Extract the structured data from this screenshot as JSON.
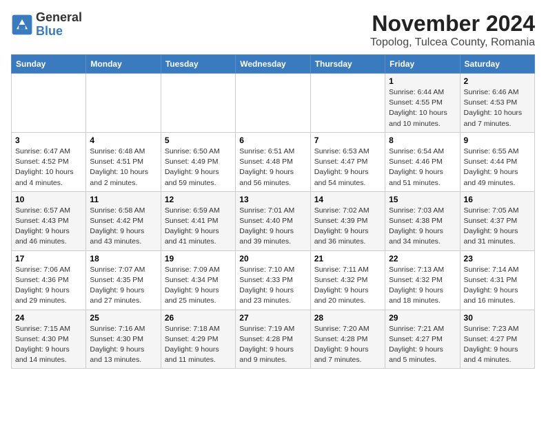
{
  "header": {
    "logo_general": "General",
    "logo_blue": "Blue",
    "title": "November 2024",
    "subtitle": "Topolog, Tulcea County, Romania"
  },
  "calendar": {
    "weekdays": [
      "Sunday",
      "Monday",
      "Tuesday",
      "Wednesday",
      "Thursday",
      "Friday",
      "Saturday"
    ],
    "weeks": [
      [
        {
          "day": "",
          "info": ""
        },
        {
          "day": "",
          "info": ""
        },
        {
          "day": "",
          "info": ""
        },
        {
          "day": "",
          "info": ""
        },
        {
          "day": "",
          "info": ""
        },
        {
          "day": "1",
          "info": "Sunrise: 6:44 AM\nSunset: 4:55 PM\nDaylight: 10 hours and 10 minutes."
        },
        {
          "day": "2",
          "info": "Sunrise: 6:46 AM\nSunset: 4:53 PM\nDaylight: 10 hours and 7 minutes."
        }
      ],
      [
        {
          "day": "3",
          "info": "Sunrise: 6:47 AM\nSunset: 4:52 PM\nDaylight: 10 hours and 4 minutes."
        },
        {
          "day": "4",
          "info": "Sunrise: 6:48 AM\nSunset: 4:51 PM\nDaylight: 10 hours and 2 minutes."
        },
        {
          "day": "5",
          "info": "Sunrise: 6:50 AM\nSunset: 4:49 PM\nDaylight: 9 hours and 59 minutes."
        },
        {
          "day": "6",
          "info": "Sunrise: 6:51 AM\nSunset: 4:48 PM\nDaylight: 9 hours and 56 minutes."
        },
        {
          "day": "7",
          "info": "Sunrise: 6:53 AM\nSunset: 4:47 PM\nDaylight: 9 hours and 54 minutes."
        },
        {
          "day": "8",
          "info": "Sunrise: 6:54 AM\nSunset: 4:46 PM\nDaylight: 9 hours and 51 minutes."
        },
        {
          "day": "9",
          "info": "Sunrise: 6:55 AM\nSunset: 4:44 PM\nDaylight: 9 hours and 49 minutes."
        }
      ],
      [
        {
          "day": "10",
          "info": "Sunrise: 6:57 AM\nSunset: 4:43 PM\nDaylight: 9 hours and 46 minutes."
        },
        {
          "day": "11",
          "info": "Sunrise: 6:58 AM\nSunset: 4:42 PM\nDaylight: 9 hours and 43 minutes."
        },
        {
          "day": "12",
          "info": "Sunrise: 6:59 AM\nSunset: 4:41 PM\nDaylight: 9 hours and 41 minutes."
        },
        {
          "day": "13",
          "info": "Sunrise: 7:01 AM\nSunset: 4:40 PM\nDaylight: 9 hours and 39 minutes."
        },
        {
          "day": "14",
          "info": "Sunrise: 7:02 AM\nSunset: 4:39 PM\nDaylight: 9 hours and 36 minutes."
        },
        {
          "day": "15",
          "info": "Sunrise: 7:03 AM\nSunset: 4:38 PM\nDaylight: 9 hours and 34 minutes."
        },
        {
          "day": "16",
          "info": "Sunrise: 7:05 AM\nSunset: 4:37 PM\nDaylight: 9 hours and 31 minutes."
        }
      ],
      [
        {
          "day": "17",
          "info": "Sunrise: 7:06 AM\nSunset: 4:36 PM\nDaylight: 9 hours and 29 minutes."
        },
        {
          "day": "18",
          "info": "Sunrise: 7:07 AM\nSunset: 4:35 PM\nDaylight: 9 hours and 27 minutes."
        },
        {
          "day": "19",
          "info": "Sunrise: 7:09 AM\nSunset: 4:34 PM\nDaylight: 9 hours and 25 minutes."
        },
        {
          "day": "20",
          "info": "Sunrise: 7:10 AM\nSunset: 4:33 PM\nDaylight: 9 hours and 23 minutes."
        },
        {
          "day": "21",
          "info": "Sunrise: 7:11 AM\nSunset: 4:32 PM\nDaylight: 9 hours and 20 minutes."
        },
        {
          "day": "22",
          "info": "Sunrise: 7:13 AM\nSunset: 4:32 PM\nDaylight: 9 hours and 18 minutes."
        },
        {
          "day": "23",
          "info": "Sunrise: 7:14 AM\nSunset: 4:31 PM\nDaylight: 9 hours and 16 minutes."
        }
      ],
      [
        {
          "day": "24",
          "info": "Sunrise: 7:15 AM\nSunset: 4:30 PM\nDaylight: 9 hours and 14 minutes."
        },
        {
          "day": "25",
          "info": "Sunrise: 7:16 AM\nSunset: 4:30 PM\nDaylight: 9 hours and 13 minutes."
        },
        {
          "day": "26",
          "info": "Sunrise: 7:18 AM\nSunset: 4:29 PM\nDaylight: 9 hours and 11 minutes."
        },
        {
          "day": "27",
          "info": "Sunrise: 7:19 AM\nSunset: 4:28 PM\nDaylight: 9 hours and 9 minutes."
        },
        {
          "day": "28",
          "info": "Sunrise: 7:20 AM\nSunset: 4:28 PM\nDaylight: 9 hours and 7 minutes."
        },
        {
          "day": "29",
          "info": "Sunrise: 7:21 AM\nSunset: 4:27 PM\nDaylight: 9 hours and 5 minutes."
        },
        {
          "day": "30",
          "info": "Sunrise: 7:23 AM\nSunset: 4:27 PM\nDaylight: 9 hours and 4 minutes."
        }
      ]
    ]
  }
}
